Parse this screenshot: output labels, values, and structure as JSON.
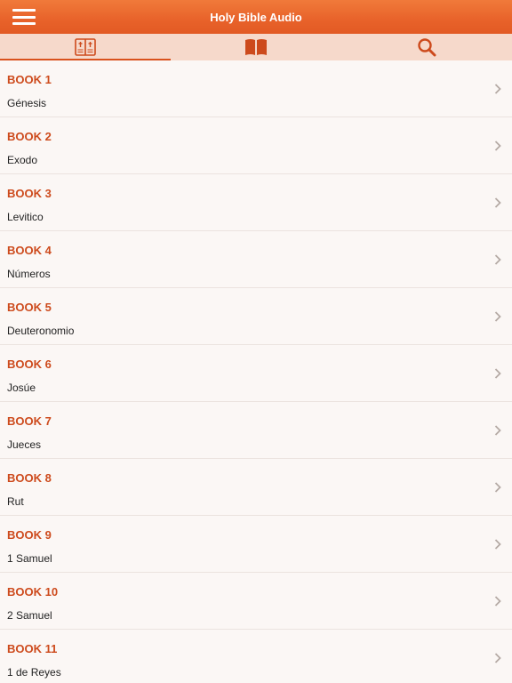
{
  "app": {
    "title": "Holy Bible Audio"
  },
  "tabs": [
    {
      "icon": "open-bible-icon",
      "active": true
    },
    {
      "icon": "book-icon",
      "active": false
    },
    {
      "icon": "search-icon",
      "active": false
    }
  ],
  "colors": {
    "header": "#e8622a",
    "tabbar": "#f6d9cb",
    "accent": "#cd4a1c",
    "background": "#fbf7f5"
  },
  "books": [
    {
      "label": "BOOK 1",
      "name": "Génesis"
    },
    {
      "label": "BOOK 2",
      "name": "Exodo"
    },
    {
      "label": "BOOK 3",
      "name": "Levitico"
    },
    {
      "label": "BOOK 4",
      "name": "Números"
    },
    {
      "label": "BOOK 5",
      "name": "Deuteronomio"
    },
    {
      "label": "BOOK 6",
      "name": "Josúe"
    },
    {
      "label": "BOOK 7",
      "name": "Jueces"
    },
    {
      "label": "BOOK 8",
      "name": "Rut"
    },
    {
      "label": "BOOK 9",
      "name": "1 Samuel"
    },
    {
      "label": "BOOK 10",
      "name": "2 Samuel"
    },
    {
      "label": "BOOK 11",
      "name": "1 de Reyes"
    }
  ]
}
